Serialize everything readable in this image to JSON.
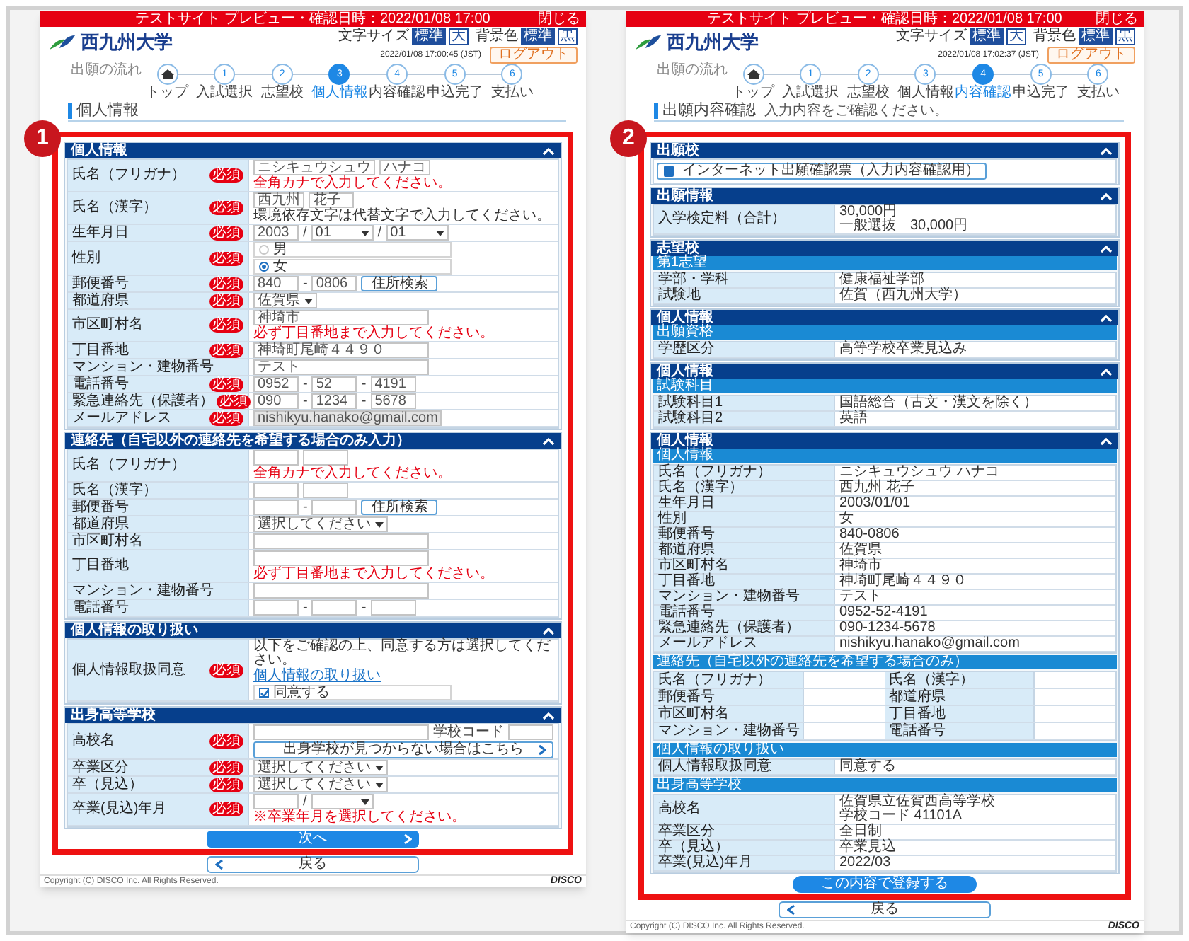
{
  "screens": [
    {
      "badge": "1",
      "banner": "テストサイト プレビュー・確認日時：2022/01/08 17:00",
      "banner_link": "閉じる",
      "logo": "西九州大学",
      "header_controls": [
        {
          "label": "文字サイズ",
          "options": [
            {
              "label": "標準",
              "selected": true
            },
            {
              "label": "大",
              "selected": false
            }
          ]
        },
        {
          "label": "背景色",
          "options": [
            {
              "label": "標準",
              "selected": true
            },
            {
              "label": "黒",
              "selected": false
            }
          ]
        }
      ],
      "datetime": "2022/01/08 17:00:45 (JST)",
      "logout": "ログアウト",
      "breadcrumb": "出願の流れ",
      "steps": [
        {
          "kind": "home",
          "label": "トップ",
          "current": false
        },
        {
          "kind": "number",
          "number": "1",
          "label": "入試選択",
          "current": false
        },
        {
          "kind": "number",
          "number": "2",
          "label": "志望校",
          "current": false
        },
        {
          "kind": "number",
          "number": "3",
          "label": "個人情報",
          "current": true
        },
        {
          "kind": "number",
          "number": "4",
          "label": "内容確認",
          "current": false
        },
        {
          "kind": "number",
          "number": "5",
          "label": "申込完了",
          "current": false
        },
        {
          "kind": "number",
          "number": "6",
          "label": "支払い",
          "current": false
        }
      ],
      "title": "個人情報",
      "sections": [
        {
          "title": "個人情報",
          "groups": [
            {
              "rows": [
                {
                  "label": "氏名（フリガナ）",
                  "required": true,
                  "badge": "必須",
                  "fields": [
                    {
                      "kind": "short_input",
                      "value": "ニシキュウシュウ"
                    },
                    {
                      "kind": "short_input",
                      "value": "ハナコ"
                    },
                    {
                      "kind": "error",
                      "text": "全角カナで入力してください。"
                    }
                  ]
                },
                {
                  "label": "氏名（漢字）",
                  "required": true,
                  "badge": "必須",
                  "fields": [
                    {
                      "kind": "short_input",
                      "value": "西九州"
                    },
                    {
                      "kind": "short_input",
                      "value": "花子"
                    },
                    {
                      "kind": "note",
                      "text": "環境依存文字は代替文字で入力してください。"
                    }
                  ]
                },
                {
                  "label": "生年月日",
                  "required": true,
                  "badge": "必須",
                  "fields": [
                    {
                      "kind": "short_input",
                      "value": "2003"
                    },
                    {
                      "kind": "sep",
                      "text": "/"
                    },
                    {
                      "kind": "select",
                      "value": "01"
                    },
                    {
                      "kind": "sep",
                      "text": "/"
                    },
                    {
                      "kind": "select",
                      "value": "01"
                    }
                  ]
                },
                {
                  "label": "性別",
                  "required": true,
                  "badge": "必須",
                  "fields": [
                    {
                      "kind": "radio",
                      "label": "男",
                      "selected": false
                    },
                    {
                      "kind": "radio",
                      "label": "女",
                      "selected": true
                    }
                  ]
                },
                {
                  "label": "郵便番号",
                  "required": true,
                  "badge": "必須",
                  "fields": [
                    {
                      "kind": "short_input",
                      "value": "840"
                    },
                    {
                      "kind": "sep",
                      "text": "-"
                    },
                    {
                      "kind": "short_input",
                      "value": "0806"
                    },
                    {
                      "kind": "button",
                      "label": "住所検索"
                    }
                  ]
                },
                {
                  "label": "都道府県",
                  "required": true,
                  "badge": "必須",
                  "fields": [
                    {
                      "kind": "select",
                      "value": "佐賀県"
                    }
                  ]
                },
                {
                  "label": "市区町村名",
                  "required": true,
                  "badge": "必須",
                  "fields": [
                    {
                      "kind": "long_input",
                      "value": "神埼市"
                    },
                    {
                      "kind": "error",
                      "text": "必ず丁目番地まで入力してください。"
                    }
                  ]
                },
                {
                  "label": "丁目番地",
                  "required": true,
                  "badge": "必須",
                  "fields": [
                    {
                      "kind": "long_input",
                      "value": "神埼町尾崎４４９０"
                    }
                  ]
                },
                {
                  "label": "マンション・建物番号",
                  "required": false,
                  "fields": [
                    {
                      "kind": "long_input",
                      "value": "テスト"
                    }
                  ]
                },
                {
                  "label": "電話番号",
                  "required": true,
                  "badge": "必須",
                  "fields": [
                    {
                      "kind": "short_input",
                      "value": "0952"
                    },
                    {
                      "kind": "sep",
                      "text": "-"
                    },
                    {
                      "kind": "short_input",
                      "value": "52"
                    },
                    {
                      "kind": "sep",
                      "text": "-"
                    },
                    {
                      "kind": "short_input",
                      "value": "4191"
                    }
                  ]
                },
                {
                  "label": "緊急連絡先（保護者）",
                  "required": true,
                  "badge": "必須",
                  "fields": [
                    {
                      "kind": "short_input",
                      "value": "090"
                    },
                    {
                      "kind": "sep",
                      "text": "-"
                    },
                    {
                      "kind": "short_input",
                      "value": "1234"
                    },
                    {
                      "kind": "sep",
                      "text": "-"
                    },
                    {
                      "kind": "short_input",
                      "value": "5678"
                    }
                  ]
                },
                {
                  "label": "メールアドレス",
                  "required": true,
                  "badge": "必須",
                  "fields": [
                    {
                      "kind": "long_input",
                      "value": "nishikyu.hanako@gmail.com",
                      "disabled": true
                    }
                  ]
                }
              ]
            }
          ]
        },
        {
          "title": "連絡先（自宅以外の連絡先を希望する場合のみ入力）",
          "groups": [
            {
              "rows": [
                {
                  "label": "氏名（フリガナ）",
                  "required": false,
                  "fields": [
                    {
                      "kind": "short_input"
                    },
                    {
                      "kind": "short_input"
                    },
                    {
                      "kind": "error",
                      "text": "全角カナで入力してください。"
                    }
                  ]
                },
                {
                  "label": "氏名（漢字）",
                  "required": false,
                  "fields": [
                    {
                      "kind": "short_input"
                    },
                    {
                      "kind": "short_input"
                    }
                  ]
                },
                {
                  "label": "郵便番号",
                  "required": false,
                  "fields": [
                    {
                      "kind": "short_input"
                    },
                    {
                      "kind": "sep",
                      "text": "-"
                    },
                    {
                      "kind": "short_input"
                    },
                    {
                      "kind": "button",
                      "label": "住所検索"
                    }
                  ]
                },
                {
                  "label": "都道府県",
                  "required": false,
                  "fields": [
                    {
                      "kind": "select",
                      "value": "選択してください"
                    }
                  ]
                },
                {
                  "label": "市区町村名",
                  "required": false,
                  "fields": [
                    {
                      "kind": "long_input"
                    }
                  ]
                },
                {
                  "label": "丁目番地",
                  "required": false,
                  "fields": [
                    {
                      "kind": "long_input"
                    },
                    {
                      "kind": "error",
                      "text": "必ず丁目番地まで入力してください。"
                    }
                  ]
                },
                {
                  "label": "マンション・建物番号",
                  "required": false,
                  "fields": [
                    {
                      "kind": "long_input"
                    }
                  ]
                },
                {
                  "label": "電話番号",
                  "required": false,
                  "fields": [
                    {
                      "kind": "short_input"
                    },
                    {
                      "kind": "sep",
                      "text": "-"
                    },
                    {
                      "kind": "short_input"
                    },
                    {
                      "kind": "sep",
                      "text": "-"
                    },
                    {
                      "kind": "short_input"
                    }
                  ]
                }
              ]
            }
          ]
        },
        {
          "title": "個人情報の取り扱い",
          "groups": [
            {
              "rows": [
                {
                  "label": "個人情報取扱同意",
                  "required": true,
                  "badge": "必須",
                  "fields": [
                    {
                      "kind": "note",
                      "text": "以下をご確認の上、同意する方は選択してください。"
                    },
                    {
                      "kind": "link",
                      "text": "個人情報の取り扱い"
                    },
                    {
                      "kind": "checkbox",
                      "label": "同意する",
                      "checked": true
                    }
                  ]
                }
              ]
            }
          ]
        },
        {
          "title": "出身高等学校",
          "groups": [
            {
              "rows": [
                {
                  "label": "高校名",
                  "required": true,
                  "badge": "必須",
                  "fields": [
                    {
                      "kind": "long_input"
                    },
                    {
                      "kind": "sep",
                      "text": "学校コード"
                    },
                    {
                      "kind": "short_input"
                    },
                    {
                      "kind": "wide_button",
                      "label": "出身学校が見つからない場合はこちら"
                    }
                  ]
                },
                {
                  "label": "卒業区分",
                  "required": true,
                  "badge": "必須",
                  "fields": [
                    {
                      "kind": "select",
                      "value": "選択してください"
                    }
                  ]
                },
                {
                  "label": "卒（見込）",
                  "required": true,
                  "badge": "必須",
                  "fields": [
                    {
                      "kind": "select",
                      "value": "選択してください"
                    }
                  ]
                },
                {
                  "label": "卒業(見込)年月",
                  "required": true,
                  "badge": "必須",
                  "fields": [
                    {
                      "kind": "short_input"
                    },
                    {
                      "kind": "sep",
                      "text": "/"
                    },
                    {
                      "kind": "select"
                    },
                    {
                      "kind": "error",
                      "text": "※卒業年月を選択してください。"
                    }
                  ]
                }
              ]
            }
          ]
        }
      ],
      "buttons": [
        {
          "kind": "next",
          "label": "次へ"
        },
        {
          "kind": "back",
          "label": "戻る"
        }
      ],
      "copyright": "Copyright (C) DISCO Inc. All Rights Reserved.",
      "brand": "DISCO"
    },
    {
      "badge": "2",
      "banner": "テストサイト プレビュー・確認日時：2022/01/08 17:00",
      "banner_link": "閉じる",
      "logo": "西九州大学",
      "header_controls": [
        {
          "label": "文字サイズ",
          "options": [
            {
              "label": "標準",
              "selected": true
            },
            {
              "label": "大",
              "selected": false
            }
          ]
        },
        {
          "label": "背景色",
          "options": [
            {
              "label": "標準",
              "selected": true
            },
            {
              "label": "黒",
              "selected": false
            }
          ]
        }
      ],
      "datetime": "2022/01/08 17:02:37 (JST)",
      "logout": "ログアウト",
      "breadcrumb": "出願の流れ",
      "steps": [
        {
          "kind": "home",
          "label": "トップ",
          "current": false
        },
        {
          "kind": "number",
          "number": "1",
          "label": "入試選択",
          "current": false
        },
        {
          "kind": "number",
          "number": "2",
          "label": "志望校",
          "current": false
        },
        {
          "kind": "number",
          "number": "3",
          "label": "個人情報",
          "current": false
        },
        {
          "kind": "number",
          "number": "4",
          "label": "内容確認",
          "current": true
        },
        {
          "kind": "number",
          "number": "5",
          "label": "申込完了",
          "current": false
        },
        {
          "kind": "number",
          "number": "6",
          "label": "支払い",
          "current": false
        }
      ],
      "title": "出願内容確認",
      "subtitle": "入力内容をご確認ください。",
      "sections": [
        {
          "title": "出願校",
          "groups": [
            {
              "rows": [
                {
                  "kind": "button",
                  "label": "インターネット出願確認票（入力内容確認用）"
                }
              ]
            }
          ]
        },
        {
          "title": "出願情報",
          "groups": [
            {
              "rows": [
                {
                  "label": "入学検定料（合計）",
                  "values": [
                    "30,000円",
                    "一般選抜　30,000円"
                  ]
                }
              ]
            }
          ]
        },
        {
          "title": "志望校",
          "groups": [
            {
              "title": "第1志望",
              "rows": [
                {
                  "label": "学部・学科",
                  "values": [
                    "健康福祉学部"
                  ]
                },
                {
                  "label": "試験地",
                  "values": [
                    "佐賀（西九州大学）"
                  ]
                }
              ]
            }
          ]
        },
        {
          "title": "個人情報",
          "groups": [
            {
              "title": "出願資格",
              "rows": [
                {
                  "label": "学歴区分",
                  "values": [
                    "高等学校卒業見込み"
                  ]
                }
              ]
            }
          ]
        },
        {
          "title": "個人情報",
          "groups": [
            {
              "title": "試験科目",
              "rows": [
                {
                  "label": "試験科目1",
                  "values": [
                    "国語総合（古文・漢文を除く）"
                  ]
                },
                {
                  "label": "試験科目2",
                  "values": [
                    "英語"
                  ]
                }
              ]
            }
          ]
        },
        {
          "title": "個人情報",
          "groups": [
            {
              "title": "個人情報",
              "rows": [
                {
                  "label": "氏名（フリガナ）",
                  "values": [
                    "ニシキュウシュウ ハナコ"
                  ]
                },
                {
                  "label": "氏名（漢字）",
                  "values": [
                    "西九州 花子"
                  ]
                },
                {
                  "label": "生年月日",
                  "values": [
                    "2003/01/01"
                  ]
                },
                {
                  "label": "性別",
                  "values": [
                    "女"
                  ]
                },
                {
                  "label": "郵便番号",
                  "values": [
                    "840-0806"
                  ]
                },
                {
                  "label": "都道府県",
                  "values": [
                    "佐賀県"
                  ]
                },
                {
                  "label": "市区町村名",
                  "values": [
                    "神埼市"
                  ]
                },
                {
                  "label": "丁目番地",
                  "values": [
                    "神埼町尾崎４４９０"
                  ]
                },
                {
                  "label": "マンション・建物番号",
                  "values": [
                    "テスト"
                  ]
                },
                {
                  "label": "電話番号",
                  "values": [
                    "0952-52-4191"
                  ]
                },
                {
                  "label": "緊急連絡先（保護者）",
                  "values": [
                    "090-1234-5678"
                  ]
                },
                {
                  "label": "メールアドレス",
                  "values": [
                    "nishikyu.hanako@gmail.com"
                  ]
                }
              ]
            },
            {
              "title": "連絡先（自宅以外の連絡先を希望する場合のみ）",
              "rows": [
                {
                  "label": "氏名（フリガナ）"
                },
                {
                  "label": "氏名（漢字）"
                },
                {
                  "label": "郵便番号"
                },
                {
                  "label": "都道府県"
                },
                {
                  "label": "市区町村名"
                },
                {
                  "label": "丁目番地"
                },
                {
                  "label": "マンション・建物番号"
                },
                {
                  "label": "電話番号"
                }
              ]
            },
            {
              "title": "個人情報の取り扱い",
              "rows": [
                {
                  "label": "個人情報取扱同意",
                  "values": [
                    "同意する"
                  ]
                }
              ]
            },
            {
              "title": "出身高等学校",
              "rows": [
                {
                  "label": "高校名",
                  "values": [
                    "佐賀県立佐賀西高等学校",
                    "学校コード 41101A"
                  ]
                },
                {
                  "label": "卒業区分",
                  "values": [
                    "全日制"
                  ]
                },
                {
                  "label": "卒（見込）",
                  "values": [
                    "卒業見込"
                  ]
                },
                {
                  "label": "卒業(見込)年月",
                  "values": [
                    "2022/03"
                  ]
                }
              ]
            }
          ]
        }
      ],
      "buttons": [
        {
          "kind": "submit",
          "label": "この内容で登録する"
        },
        {
          "kind": "back",
          "label": "戻る"
        }
      ],
      "copyright": "Copyright (C) DISCO Inc. All Rights Reserved.",
      "brand": "DISCO"
    }
  ]
}
